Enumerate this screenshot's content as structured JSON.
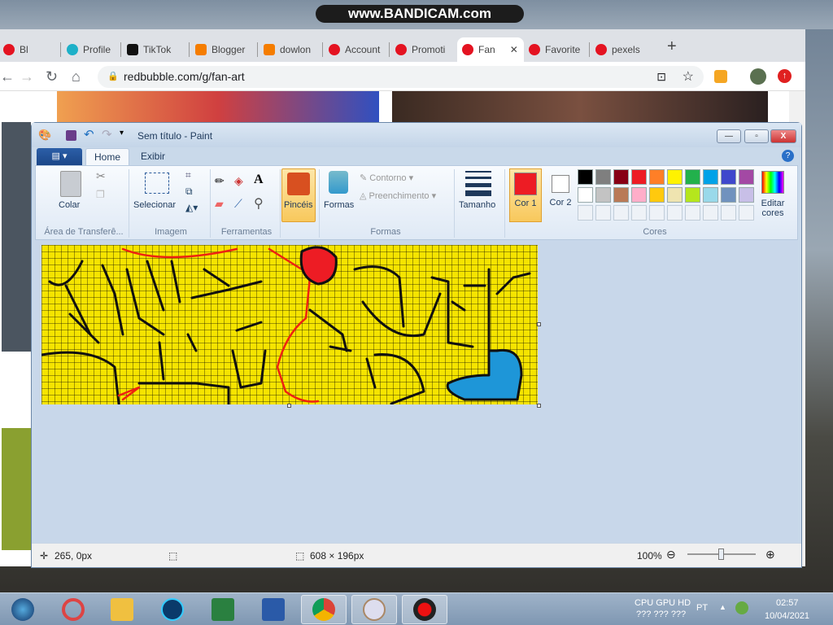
{
  "overlay": {
    "bandicam_watermark": "www.BANDICAM.com"
  },
  "browser": {
    "tabs": [
      {
        "label": "Bl",
        "icon": "youtube-icon"
      },
      {
        "label": "Profile",
        "icon": "play-icon"
      },
      {
        "label": "TikTok",
        "icon": "tiktok-icon"
      },
      {
        "label": "Blogger",
        "icon": "blogger-icon"
      },
      {
        "label": "dowlon",
        "icon": "blogger-icon"
      },
      {
        "label": "Account",
        "icon": "redbubble-icon"
      },
      {
        "label": "Promoti",
        "icon": "redbubble-icon"
      },
      {
        "label": "Fan",
        "icon": "redbubble-icon",
        "active": true
      },
      {
        "label": "Favorite",
        "icon": "redbubble-icon"
      },
      {
        "label": "pexels",
        "icon": "redbubble-icon"
      }
    ],
    "url": "redbubble.com/g/fan-art"
  },
  "paint": {
    "title": "Sem título - Paint",
    "tabs": [
      "Home",
      "Exibir"
    ],
    "groups": {
      "clipboard": {
        "label": "Área de Transferê...",
        "paste": "Colar"
      },
      "image": {
        "label": "Imagem",
        "select": "Selecionar"
      },
      "tools": {
        "label": "Ferramentas"
      },
      "brushes": {
        "label": "Pincéis"
      },
      "shapes": {
        "label": "Formas",
        "shapes": "Formas",
        "outline": "Contorno",
        "fill": "Preenchimento"
      },
      "size": {
        "label": "Tamanho"
      },
      "colors": {
        "label": "Cores",
        "color1": "Cor 1",
        "color2": "Cor 2",
        "edit": "Editar cores",
        "color1_value": "#ed1c24",
        "color2_value": "#ffffff",
        "palette_row1": [
          "#000000",
          "#7f7f7f",
          "#880015",
          "#ed1c24",
          "#ff7f27",
          "#fff200",
          "#22b14c",
          "#00a2e8",
          "#3f48cc",
          "#a349a4"
        ],
        "palette_row2": [
          "#ffffff",
          "#c3c3c3",
          "#b97a57",
          "#ffaec9",
          "#ffc90e",
          "#efe4b0",
          "#b5e61d",
          "#99d9ea",
          "#7092be",
          "#c8bfe7"
        ]
      }
    },
    "status": {
      "cursor": "265, 0px",
      "size": "608 × 196px",
      "zoom": "100%",
      "zoom_level": 100
    }
  },
  "taskbar": {
    "cpu_label": "CPU GPU HD",
    "cpu_values": "???  ???  ???",
    "lang": "PT",
    "time": "02:57",
    "date": "10/04/2021"
  }
}
